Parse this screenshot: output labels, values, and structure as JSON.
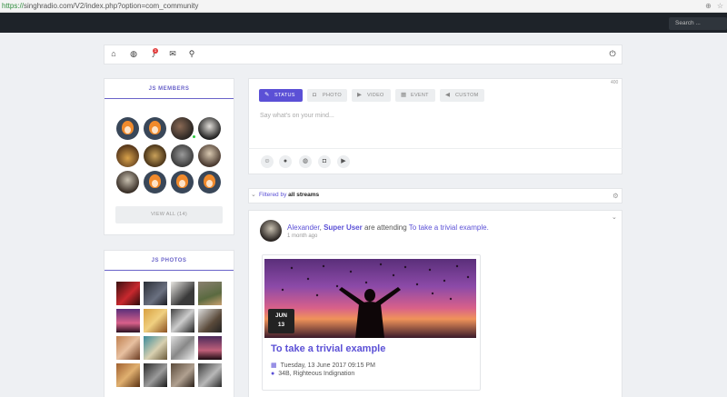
{
  "browser": {
    "url_scheme": "https://",
    "url_rest": "singhradio.com/V2/index.php?option=com_community"
  },
  "topnav": {
    "search_placeholder": "Search ..."
  },
  "toolbar": {
    "icons": [
      "home-icon",
      "globe-icon",
      "bell-icon",
      "mail-icon",
      "search-icon",
      "power-icon"
    ],
    "notification_count": "1"
  },
  "members": {
    "title": "JS MEMBERS",
    "view_all": "VIEW ALL (14)"
  },
  "photos": {
    "title": "JS PHOTOS"
  },
  "composer": {
    "char_counter": "400",
    "tabs": [
      {
        "label": "STATUS",
        "icon": "pencil-icon"
      },
      {
        "label": "PHOTO",
        "icon": "camera-icon"
      },
      {
        "label": "VIDEO",
        "icon": "video-icon"
      },
      {
        "label": "EVENT",
        "icon": "calendar-icon"
      },
      {
        "label": "CUSTOM",
        "icon": "megaphone-icon"
      }
    ],
    "placeholder": "Say what's on your mind...",
    "actions": [
      "emoji-icon",
      "location-icon",
      "globe-icon",
      "camera-icon",
      "video-icon"
    ]
  },
  "filter": {
    "prefix": "Filtered by",
    "value": "all streams"
  },
  "stream": {
    "actor1": "Alexander",
    "sep": ",",
    "actor2": "Super User",
    "verb": "are attending",
    "target": "To take a trivial example.",
    "time_ago": "1 month ago",
    "event": {
      "month": "JUN",
      "day": "13",
      "title": "To take a trivial example",
      "datetime": "Tuesday, 13 June 2017 09:15 PM",
      "location": "34B, Righteous Indignation"
    }
  },
  "colors": {
    "accent": "#5b50d6",
    "nav": "#1e2329",
    "bg": "#eef0f3"
  }
}
